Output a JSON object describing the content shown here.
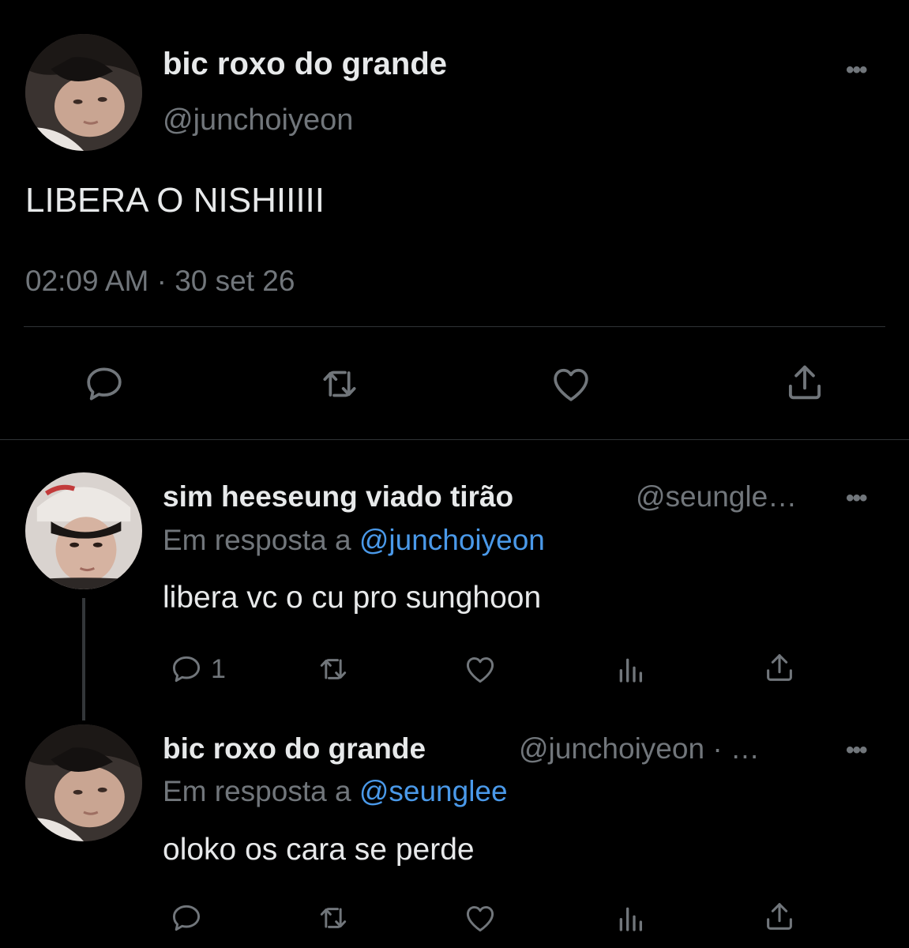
{
  "main_tweet": {
    "display_name": "bic roxo do grande",
    "handle": "@junchoiyeon",
    "more_icon": "more-horizontal-icon",
    "text": "LIBERA O NISHIIIII",
    "time": "02:09 AM",
    "separator": "·",
    "date": "30 set 26",
    "actions": [
      "reply-icon",
      "retweet-icon",
      "like-icon",
      "share-icon"
    ]
  },
  "replies": [
    {
      "display_name": "sim heeseung viado tirão",
      "handle": "@seungle…",
      "replying_prefix": "Em resposta a",
      "replying_to": "@junchoiyeon",
      "text": "libera vc o cu pro sunghoon",
      "reply_count": "1",
      "actions": [
        "reply-icon",
        "retweet-icon",
        "like-icon",
        "analytics-icon",
        "share-icon"
      ]
    },
    {
      "display_name": "bic roxo do grande",
      "handle": "@junchoiyeon · …",
      "replying_prefix": "Em resposta a",
      "replying_to": "@seunglee",
      "text": "oloko os cara se perde",
      "actions": [
        "reply-icon",
        "retweet-icon",
        "like-icon",
        "analytics-icon",
        "share-icon"
      ]
    }
  ],
  "colors": {
    "background": "#000000",
    "primary_text": "#e7e9ea",
    "secondary_text": "#71767b",
    "mention": "#4a99e9",
    "divider": "#2f3336"
  }
}
